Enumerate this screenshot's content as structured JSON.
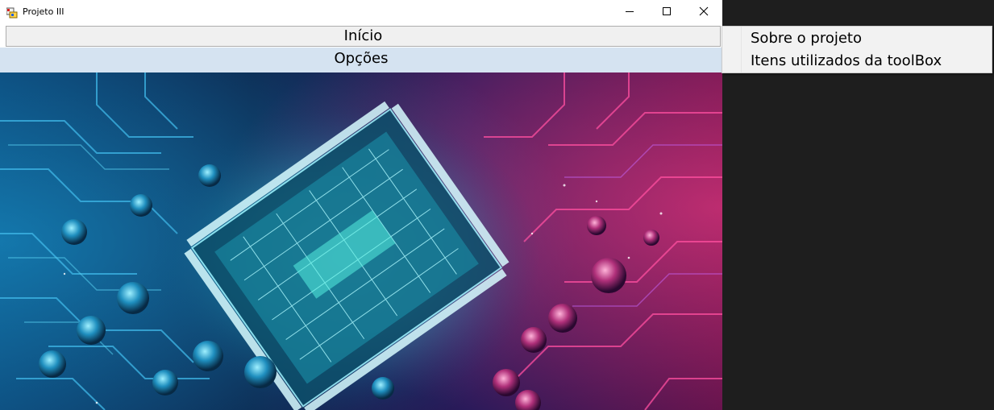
{
  "window": {
    "title": "Projeto III",
    "icon": "app-icon"
  },
  "controls": {
    "minimize": "minimize-icon",
    "maximize": "maximize-icon",
    "close": "close-icon"
  },
  "main": {
    "inicio_label": "Início",
    "opcoes_label": "Opções",
    "hero_image": "circuit-board-chip-image"
  },
  "dropdown": {
    "items": [
      {
        "label": "Sobre o projeto"
      },
      {
        "label": "Itens utilizados da toolBox"
      }
    ]
  },
  "colors": {
    "menu_highlight": "#d5e3f1",
    "desktop_background": "#1e1e1e",
    "chip_glow": "#3ee6e6",
    "circuit_pink": "#e0407a"
  }
}
